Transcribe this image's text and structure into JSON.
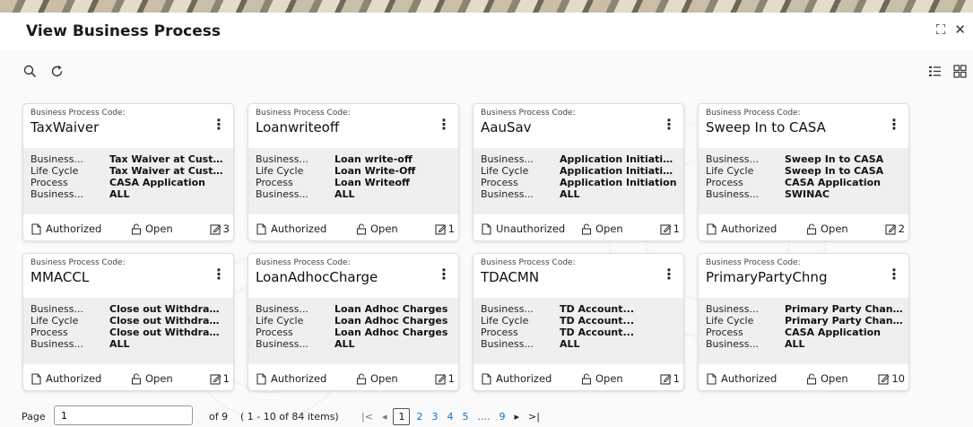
{
  "window": {
    "title": "View Business Process"
  },
  "toolbar": {
    "search_icon": "search-icon",
    "refresh_icon": "refresh-icon",
    "list_view_icon": "list-view-icon",
    "grid_view_icon": "grid-view-icon"
  },
  "cards": [
    {
      "code_label": "Business Process Code:",
      "code": "TaxWaiver",
      "rows": [
        {
          "k": "Business...",
          "v": "Tax Waiver at Custom..."
        },
        {
          "k": "Life Cycle",
          "v": "Tax Waiver at Custom..."
        },
        {
          "k": "Process",
          "v": "CASA Application"
        },
        {
          "k": "Business...",
          "v": "ALL"
        }
      ],
      "status": "Authorized",
      "open": "Open",
      "count": "3"
    },
    {
      "code_label": "Business Process Code:",
      "code": "Loanwriteoff",
      "rows": [
        {
          "k": "Business...",
          "v": "Loan write-off"
        },
        {
          "k": "Life Cycle",
          "v": "Loan Write-Off"
        },
        {
          "k": "Process",
          "v": "Loan Writeoff"
        },
        {
          "k": "Business...",
          "v": "ALL"
        }
      ],
      "status": "Authorized",
      "open": "Open",
      "count": "1"
    },
    {
      "code_label": "Business Process Code:",
      "code": "AauSav",
      "rows": [
        {
          "k": "Business...",
          "v": "Application Initiation..."
        },
        {
          "k": "Life Cycle",
          "v": "Application Initiation..."
        },
        {
          "k": "Process",
          "v": "Application Initiation"
        },
        {
          "k": "Business...",
          "v": "ALL"
        }
      ],
      "status": "Unauthorized",
      "open": "Open",
      "count": "1"
    },
    {
      "code_label": "Business Process Code:",
      "code": "Sweep In to CASA",
      "rows": [
        {
          "k": "Business...",
          "v": "Sweep In to CASA"
        },
        {
          "k": "Life Cycle",
          "v": "Sweep In to CASA"
        },
        {
          "k": "Process",
          "v": "CASA Application"
        },
        {
          "k": "Business...",
          "v": "SWINAC"
        }
      ],
      "status": "Authorized",
      "open": "Open",
      "count": "2"
    },
    {
      "code_label": "Business Process Code:",
      "code": "MMACCL",
      "rows": [
        {
          "k": "Business...",
          "v": "Close out Withdrawal..."
        },
        {
          "k": "Life Cycle",
          "v": "Close out Withdrawal..."
        },
        {
          "k": "Process",
          "v": "Close out Withdrawal..."
        },
        {
          "k": "Business...",
          "v": "ALL"
        }
      ],
      "status": "Authorized",
      "open": "Open",
      "count": "1"
    },
    {
      "code_label": "Business Process Code:",
      "code": "LoanAdhocCharge",
      "rows": [
        {
          "k": "Business...",
          "v": "Loan Adhoc Charges"
        },
        {
          "k": "Life Cycle",
          "v": "Loan Adhoc Charges"
        },
        {
          "k": "Process",
          "v": "Loan Adhoc Charges"
        },
        {
          "k": "Business...",
          "v": "ALL"
        }
      ],
      "status": "Authorized",
      "open": "Open",
      "count": "1"
    },
    {
      "code_label": "Business Process Code:",
      "code": "TDACMN",
      "rows": [
        {
          "k": "Business...",
          "v": "TD Account..."
        },
        {
          "k": "Life Cycle",
          "v": "TD Account..."
        },
        {
          "k": "Process",
          "v": "TD Account..."
        },
        {
          "k": "Business...",
          "v": "ALL"
        }
      ],
      "status": "Authorized",
      "open": "Open",
      "count": "1"
    },
    {
      "code_label": "Business Process Code:",
      "code": "PrimaryPartyChng",
      "rows": [
        {
          "k": "Business...",
          "v": "Primary Party Change"
        },
        {
          "k": "Life Cycle",
          "v": "Primary Party Change"
        },
        {
          "k": "Process",
          "v": "CASA Application"
        },
        {
          "k": "Business...",
          "v": "ALL"
        }
      ],
      "status": "Authorized",
      "open": "Open",
      "count": "10"
    }
  ],
  "pagination": {
    "page_label": "Page",
    "page_value": "1",
    "of_label": "of 9",
    "items_label": "( 1 - 10 of 84 items)",
    "first": "|<",
    "prev": "◂",
    "pages": [
      "1",
      "2",
      "3",
      "4",
      "5"
    ],
    "ellipsis": "....",
    "last_page": "9",
    "next": "▸",
    "last": ">|"
  }
}
